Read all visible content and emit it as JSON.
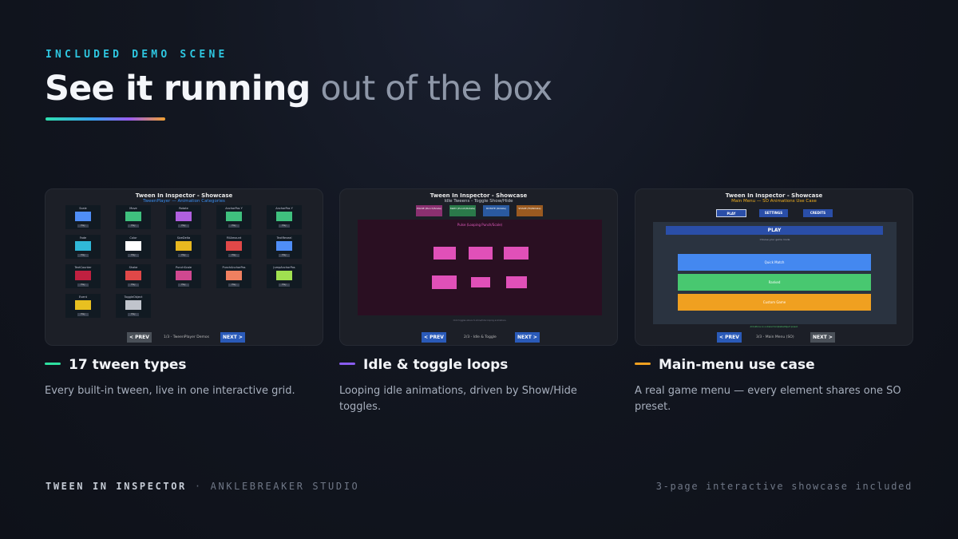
{
  "header": {
    "eyebrow": "INCLUDED DEMO SCENE",
    "headline_strong": "See it running",
    "headline_light": "out of the box"
  },
  "colors": {
    "accent_cyan": "#2ec6e0",
    "green": "#2ee0a0",
    "purple": "#8a5cf0",
    "orange": "#f0a020"
  },
  "cards": [
    {
      "shot": {
        "title": "Tween In Inspector - Showcase",
        "subtitle": "TweenPlayer — Animation Categories",
        "prev": "< PREV",
        "page": "1/3 - TweenPlayer Demos",
        "next": "NEXT >",
        "cells": [
          {
            "label": "Scale",
            "color": "#4f8ef7"
          },
          {
            "label": "Move",
            "color": "#3fc07e"
          },
          {
            "label": "Rotate",
            "color": "#b060e0"
          },
          {
            "label": "AnchorPos Y",
            "color": "#3fc07e"
          },
          {
            "label": "AnchorPos Y",
            "color": "#3fc07e"
          },
          {
            "label": "Fade",
            "color": "#30b8d8"
          },
          {
            "label": "Color",
            "color": "#ffffff"
          },
          {
            "label": "SizeDelta",
            "color": "#e8b820"
          },
          {
            "label": "FillAmount",
            "color": "#e04848"
          },
          {
            "label": "TextReveal",
            "color": "#4f8ef7"
          },
          {
            "label": "TextCounter",
            "color": "#c02040"
          },
          {
            "label": "Shake",
            "color": "#e04848"
          },
          {
            "label": "PunchScale",
            "color": "#d04890"
          },
          {
            "label": "PunchAnchorPos",
            "color": "#f08060"
          },
          {
            "label": "JumpAnchorPos",
            "color": "#a0e050"
          },
          {
            "label": "Event",
            "color": "#e8c020"
          },
          {
            "label": "ToggleObject",
            "color": "#c0c4cc"
          }
        ],
        "play_label": "Play"
      },
      "title": "17 tween types",
      "description": "Every built-in tween, live in one interactive grid."
    },
    {
      "shot": {
        "title": "Tween In Inspector - Showcase",
        "subtitle": "Idle Tweens - Toggle Show/Hide",
        "toggles": [
          {
            "label": "PULSE (Punch/Scale)",
            "color": "#8a3070"
          },
          {
            "label": "SWAY (Punch/Rotate)",
            "color": "#2a7a4a"
          },
          {
            "label": "ROTATE (Rotate)",
            "color": "#2a5aa0"
          },
          {
            "label": "SHAKE (Fill/Rotate)",
            "color": "#9a5a20"
          }
        ],
        "stage_header": "Pulse (Looping Punch/Scale)",
        "stage_footer": "Click toggles above to show/hide looping animations.",
        "prev": "< PREV",
        "page": "2/3 - Idle & Toggle",
        "next": "NEXT >"
      },
      "title": "Idle & toggle loops",
      "description": "Looping idle animations, driven by Show/Hide toggles."
    },
    {
      "shot": {
        "title": "Tween In Inspector - Showcase",
        "subtitle": "Main Menu — SO Animations Use Case",
        "tabs": [
          "PLAY",
          "SETTINGS",
          "CREDITS"
        ],
        "panel_title": "PLAY",
        "panel_hint": "Choose your game mode",
        "buttons": [
          {
            "label": "Quick Match",
            "color": "#4488f0"
          },
          {
            "label": "Ranked",
            "color": "#48c870"
          },
          {
            "label": "Custom Game",
            "color": "#f0a020"
          }
        ],
        "footer_note": "All buttons on a shared ScriptableObject preset.",
        "prev": "< PREV",
        "page": "3/3 - Main Menu (SO)",
        "next": "NEXT >"
      },
      "title": "Main-menu use case",
      "description": "A real game menu — every element shares one SO preset."
    }
  ],
  "footer": {
    "product": "TWEEN IN INSPECTOR",
    "separator": "·",
    "studio": "ANKLEBREAKER STUDIO",
    "note": "3-page interactive showcase included"
  }
}
